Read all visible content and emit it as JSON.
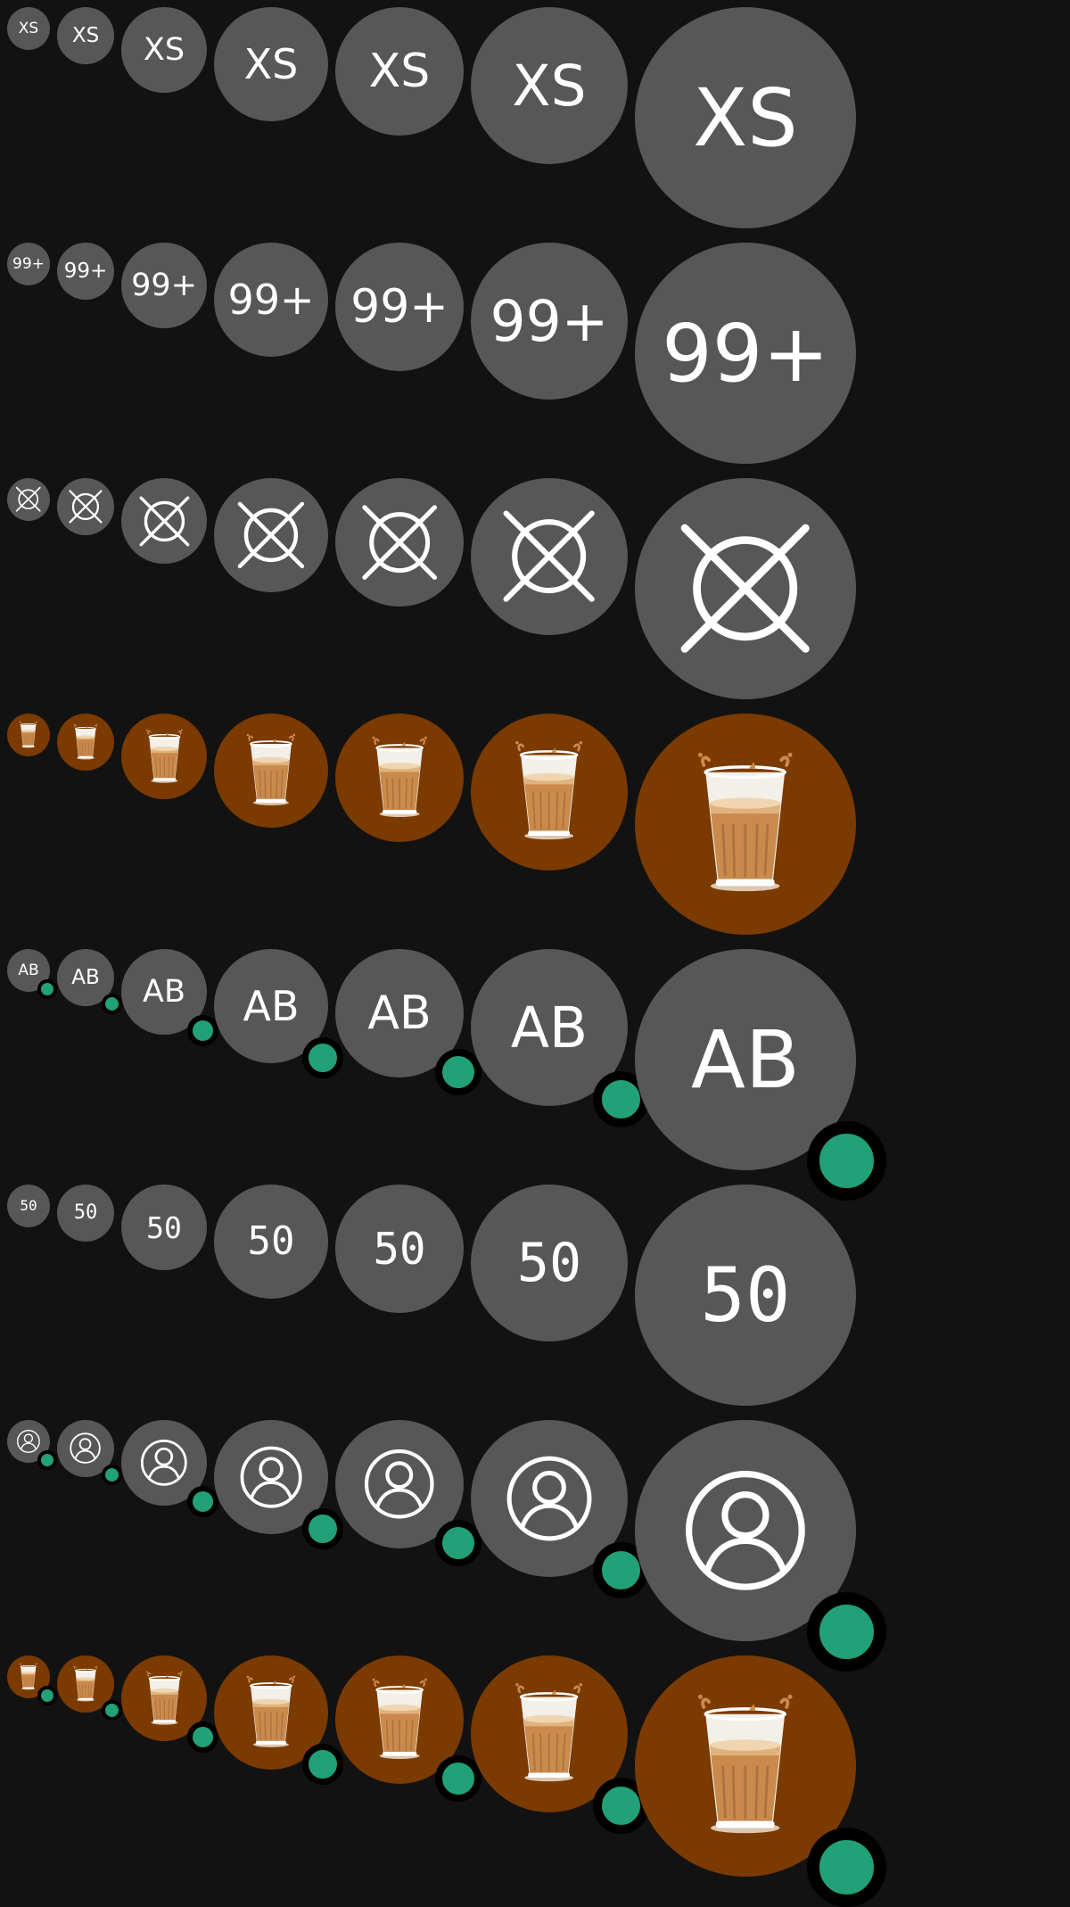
{
  "colors": {
    "background": "#121212",
    "avatar_gray": "#575757",
    "avatar_orange": "#7a3a00",
    "text": "#ffffff",
    "status_green": "#22a078",
    "status_ring": "#000000"
  },
  "rows": [
    {
      "kind": "text",
      "text": "XS",
      "mono": false,
      "badge": false
    },
    {
      "kind": "text",
      "text": "99+",
      "mono": false,
      "badge": false
    },
    {
      "kind": "icon",
      "icon": "no-image-icon",
      "badge": false
    },
    {
      "kind": "image",
      "image": "chai-glass-image",
      "badge": false
    },
    {
      "kind": "text",
      "text": "AB",
      "mono": false,
      "badge": true
    },
    {
      "kind": "text",
      "text": "50",
      "mono": true,
      "badge": false
    },
    {
      "kind": "icon",
      "icon": "user-icon",
      "badge": true
    },
    {
      "kind": "image",
      "image": "chai-glass-image",
      "badge": true
    }
  ],
  "sizes": [
    "xs",
    "sm",
    "md",
    "lg",
    "xl",
    "2xl",
    "3xl"
  ]
}
